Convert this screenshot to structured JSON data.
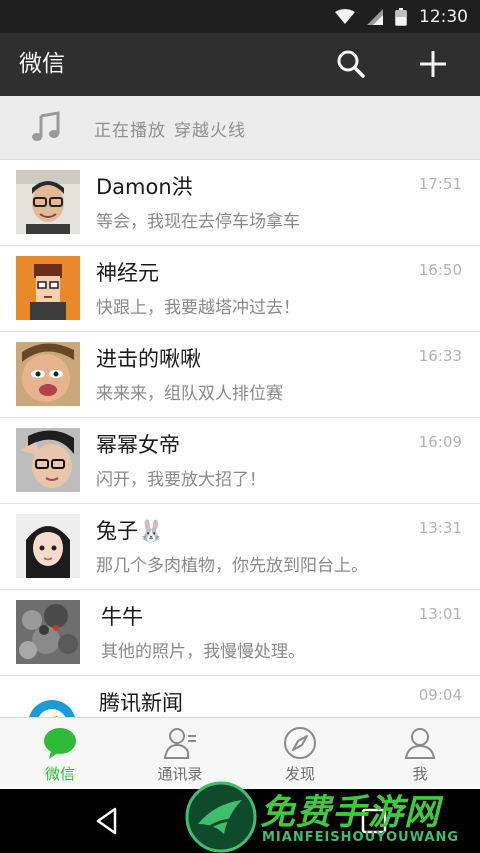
{
  "status_bar": {
    "time": "12:30",
    "icons": [
      "wifi-icon",
      "signal-icon",
      "battery-icon"
    ]
  },
  "header": {
    "title": "微信",
    "icons": [
      "search-icon",
      "plus-icon"
    ]
  },
  "now_playing": {
    "label": "正在播放",
    "song": "穿越火线",
    "icon": "music-note-icon"
  },
  "chats": [
    {
      "name": "Damon洪",
      "preview": "等会，我现在去停车场拿车",
      "time": "17:51"
    },
    {
      "name": "神经元",
      "preview": "快跟上，我要越塔冲过去！",
      "time": "16:50"
    },
    {
      "name": "进击的啾啾",
      "preview": "来来来，组队双人排位赛",
      "time": "16:33"
    },
    {
      "name": "幂幂女帝",
      "preview": "闪开，我要放大招了！",
      "time": "16:09"
    },
    {
      "name": "兔子🐰",
      "preview": "那几个多肉植物，你先放到阳台上。",
      "time": "13:31"
    },
    {
      "name": "牛牛",
      "preview": "其他的照片，我慢慢处理。",
      "time": "13:01"
    },
    {
      "name": "腾讯新闻",
      "preview": "",
      "time": "09:04"
    }
  ],
  "tabs": [
    {
      "label": "微信",
      "icon": "chat-bubble-icon",
      "active": true
    },
    {
      "label": "通讯录",
      "icon": "contacts-icon",
      "active": false
    },
    {
      "label": "发现",
      "icon": "compass-icon",
      "active": false
    },
    {
      "label": "我",
      "icon": "person-icon",
      "active": false
    }
  ],
  "nav_bar": {
    "icons": [
      "back-icon",
      "home-icon",
      "recents-icon"
    ]
  },
  "watermark": {
    "title": "免费手游网",
    "subtitle": "MIANFEISHOUYOUWANG"
  },
  "colors": {
    "accent": "#2fbb3a",
    "header_bg": "#2f2f2f",
    "status_bg": "#1f1f1f"
  }
}
